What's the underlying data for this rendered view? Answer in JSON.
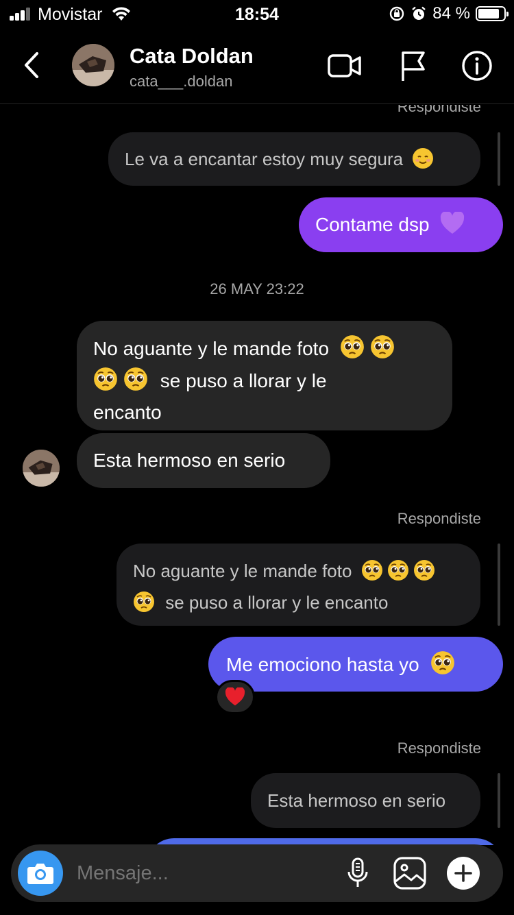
{
  "status_bar": {
    "carrier": "Movistar",
    "time": "18:54",
    "battery_pct": "84 %",
    "battery_level": 0.84
  },
  "header": {
    "name": "Cata Doldan",
    "handle": "cata___.doldan"
  },
  "chat": {
    "reply_label": "Respondiste",
    "quoted_1": "Le va a encantar estoy muy segura",
    "sent_1": "Contame dsp",
    "date_separator": "26 MAY 23:22",
    "recv_1_line1": "No aguante y le mande foto",
    "recv_1_line2": "se puso a llorar y le",
    "recv_1_line3": "encanto",
    "recv_2": "Esta hermoso en serio",
    "quoted_2_line1": "No aguante y le mande foto",
    "quoted_2_line2": "se puso a llorar y le encanto",
    "sent_2": "Me emociono hasta yo",
    "quoted_3": "Esta hermoso en serio",
    "colors": {
      "sent_purple": "#8a3ff0",
      "sent_blue": "#5b57ec",
      "received_bg": "#262626",
      "quoted_bg": "#1c1c1e"
    }
  },
  "composer": {
    "placeholder": "Mensaje..."
  },
  "icons": [
    "back-icon",
    "video-call-icon",
    "flag-icon",
    "info-icon",
    "camera-icon",
    "microphone-icon",
    "gallery-icon",
    "plus-icon",
    "pleading-face-emoji",
    "smiling-face-emoji",
    "purple-heart-emoji",
    "red-heart-emoji"
  ]
}
